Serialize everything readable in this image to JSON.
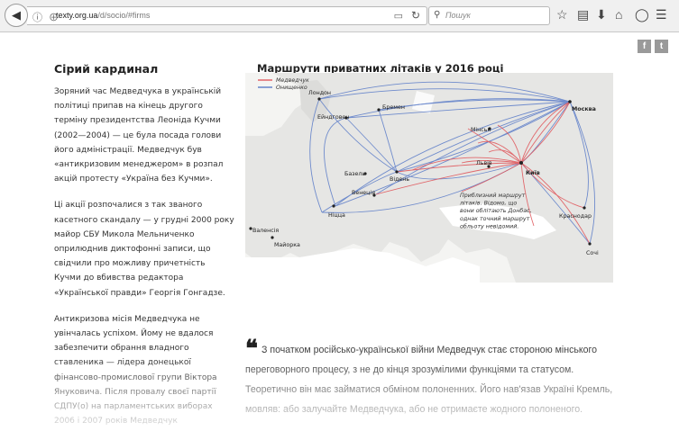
{
  "browser": {
    "url_domain": "texty.org.ua",
    "url_path": "/d/socio/#firms",
    "search_placeholder": "Пошук"
  },
  "social": {
    "facebook": "f",
    "twitter": "t"
  },
  "article": {
    "title": "Сірий кардинал",
    "p1": "Зоряний час Медведчука в українській політиці припав на кінець другого терміну президентства Леоніда Кучми (2002—2004) — це була посада голови його адміністрації. Медведчук був «антикризовим менеджером» в розпал акцій протесту «Україна без Кучми».",
    "p2": "Ці акції розпочалися з так званого касетного скандалу — у грудні 2000 року майор СБУ Микола Мельниченко оприлюднив диктофонні записи, що свідчили про можливу причетність Кучми до вбивства редактора «Української правди» Георгія Гонгадзе.",
    "p3": "Антикризова місія Медведчука не увінчалась успіхом. Йому не вдалося забезпечити обрання владного ставленика — лідера донецької фінансово-промислової групи Віктора Януковича. Після провалу своєї партії СДПУ(о) на парламентських виборах 2006 і 2007 років Медведчук"
  },
  "map": {
    "title": "Маршрути приватних літаків у 2016 році",
    "legend": [
      {
        "name": "Медведчук",
        "color": "#e05a5f"
      },
      {
        "name": "Онищенко",
        "color": "#5b7cc8"
      }
    ],
    "cities": {
      "london": "Лондон",
      "eindhoven": "Ейндговен",
      "bremen": "Бремен",
      "moscow": "Москва",
      "minsk": "Мінськ",
      "basel": "Базель",
      "vienna": "Відень",
      "lviv": "Львів",
      "kyiv": "Київ",
      "venice": "Венеція",
      "nice": "Ніцца",
      "valencia": "Валенсія",
      "mallorca": "Майорка",
      "krasnodar": "Краснодар",
      "sochi": "Сочі"
    },
    "note": "Приблизний маршрут літаків. Відомо, що вони облітають Донбас, однак точний маршрут обльоту невідомий."
  },
  "quote": {
    "mark": "❝",
    "text": "З початком російсько-української війни Медведчук стає стороною мінського переговорного процесу, з не до кінця зрозумілими функціями та статусом. Теоретично він має займатися обміном полоненних. Його нав'язав Україні Кремль, мовляв: або залучайте Медведчука, або не отримаєте жодного полоненого."
  }
}
